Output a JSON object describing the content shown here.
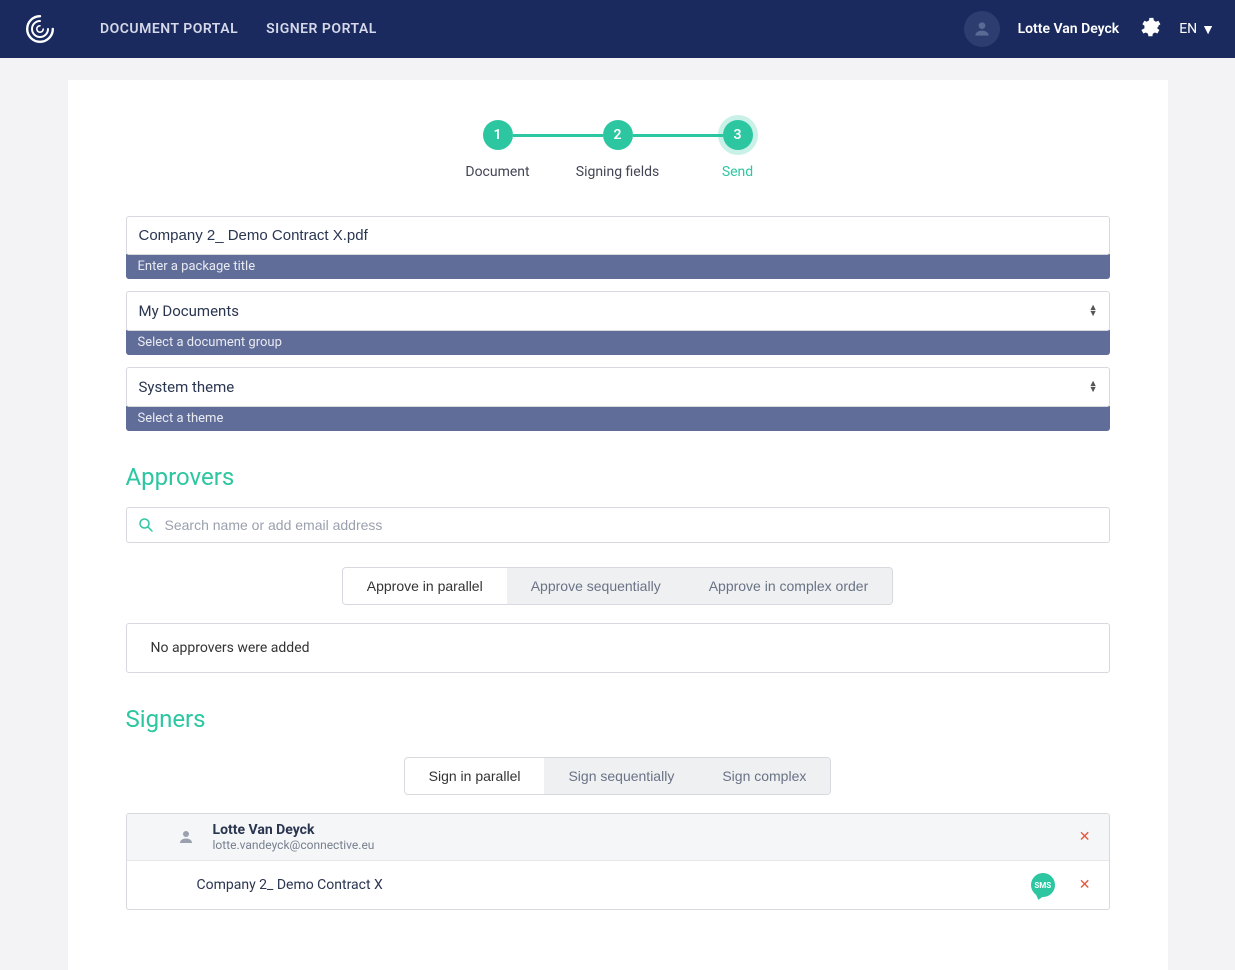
{
  "header": {
    "nav_document_portal": "DOCUMENT PORTAL",
    "nav_signer_portal": "SIGNER PORTAL",
    "user_name": "Lotte Van Deyck",
    "lang": "EN"
  },
  "stepper": {
    "step1_num": "1",
    "step1_label": "Document",
    "step2_num": "2",
    "step2_label": "Signing fields",
    "step3_num": "3",
    "step3_label": "Send"
  },
  "form": {
    "package_title_value": "Company 2_ Demo Contract X.pdf",
    "package_title_hint": "Enter a package title",
    "doc_group_value": "My Documents",
    "doc_group_hint": "Select a document group",
    "theme_value": "System theme",
    "theme_hint": "Select a theme"
  },
  "approvers": {
    "title": "Approvers",
    "search_placeholder": "Search name or add email address",
    "opt_parallel": "Approve in parallel",
    "opt_sequential": "Approve sequentially",
    "opt_complex": "Approve in complex order",
    "empty": "No approvers were added"
  },
  "signers": {
    "title": "Signers",
    "opt_parallel": "Sign in parallel",
    "opt_sequential": "Sign sequentially",
    "opt_complex": "Sign complex",
    "signer_name": "Lotte Van Deyck",
    "signer_email": "lotte.vandeyck@connective.eu",
    "doc_name": "Company 2_ Demo Contract X",
    "sms_label": "SMS"
  }
}
